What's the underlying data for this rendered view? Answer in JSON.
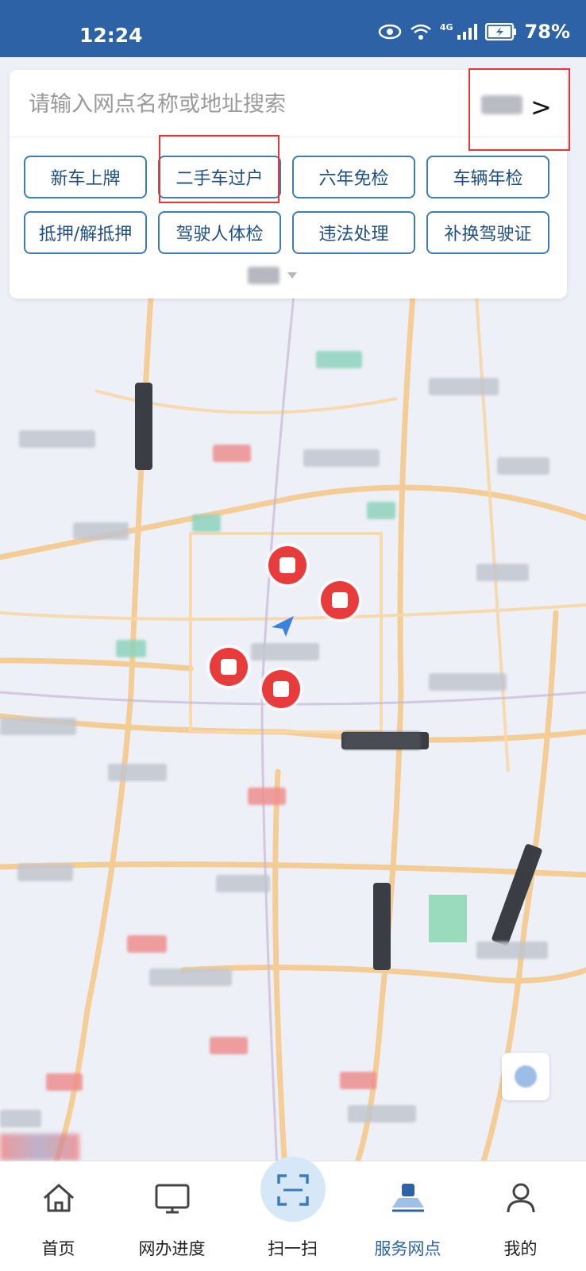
{
  "status_bar": {
    "time": "12:24",
    "network": "4G",
    "battery_percent": "78%"
  },
  "search": {
    "placeholder": "请输入网点名称或地址搜索",
    "city_chevron": ">"
  },
  "services": [
    {
      "label": "新车上牌"
    },
    {
      "label": "二手车过户"
    },
    {
      "label": "六年免检"
    },
    {
      "label": "车辆年检"
    },
    {
      "label": "抵押/解抵押"
    },
    {
      "label": "驾驶人体检"
    },
    {
      "label": "违法处理"
    },
    {
      "label": "补换驾驶证"
    }
  ],
  "tabbar": {
    "items": [
      {
        "label": "首页",
        "icon": "home-icon"
      },
      {
        "label": "网办进度",
        "icon": "monitor-icon"
      },
      {
        "label": "扫一扫",
        "icon": "scan-icon"
      },
      {
        "label": "服务网点",
        "icon": "map-outlet-icon"
      },
      {
        "label": "我的",
        "icon": "user-icon"
      }
    ],
    "active_index": 3
  },
  "colors": {
    "header": "#2d63a6",
    "accent": "#2d63a6",
    "button_border": "#3c7dbd",
    "pin": "#e83b3b",
    "highlight_box": "#ee3333"
  }
}
